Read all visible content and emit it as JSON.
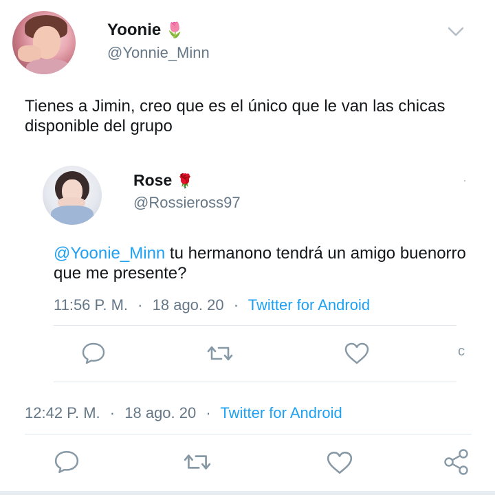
{
  "tweet": {
    "author_name": "Yoonie",
    "author_emoji": "🌷",
    "author_handle": "@Yonnie_Minn",
    "text_line1": "Tienes a Jimin, creo que es el único que le van las chicas",
    "text_line2": "disponible del grupo",
    "time": "12:42 P. M.",
    "date": "18 ago. 20",
    "source": "Twitter for Android",
    "separator": "·"
  },
  "quoted": {
    "author_name": "Rose",
    "author_emoji": "🌹",
    "author_handle": "@Rossieross97",
    "mention": "@Yoonie_Minn",
    "text_after_mention": " tu hermanono tendrá un amigo buenorro",
    "text_line2": "que me presente?",
    "time": "11:56 P. M.",
    "date": "18 ago. 20",
    "source": "Twitter for Android",
    "separator": "·",
    "dot_right": "·",
    "trailing_char": "c"
  },
  "icons": {
    "reply": "reply-icon",
    "retweet": "retweet-icon",
    "like": "like-icon",
    "share": "share-icon",
    "more": "chevron-down-icon"
  },
  "colors": {
    "link": "#1da1f2",
    "muted": "#657786",
    "text": "#14171a",
    "divider": "#e1e8ed"
  }
}
